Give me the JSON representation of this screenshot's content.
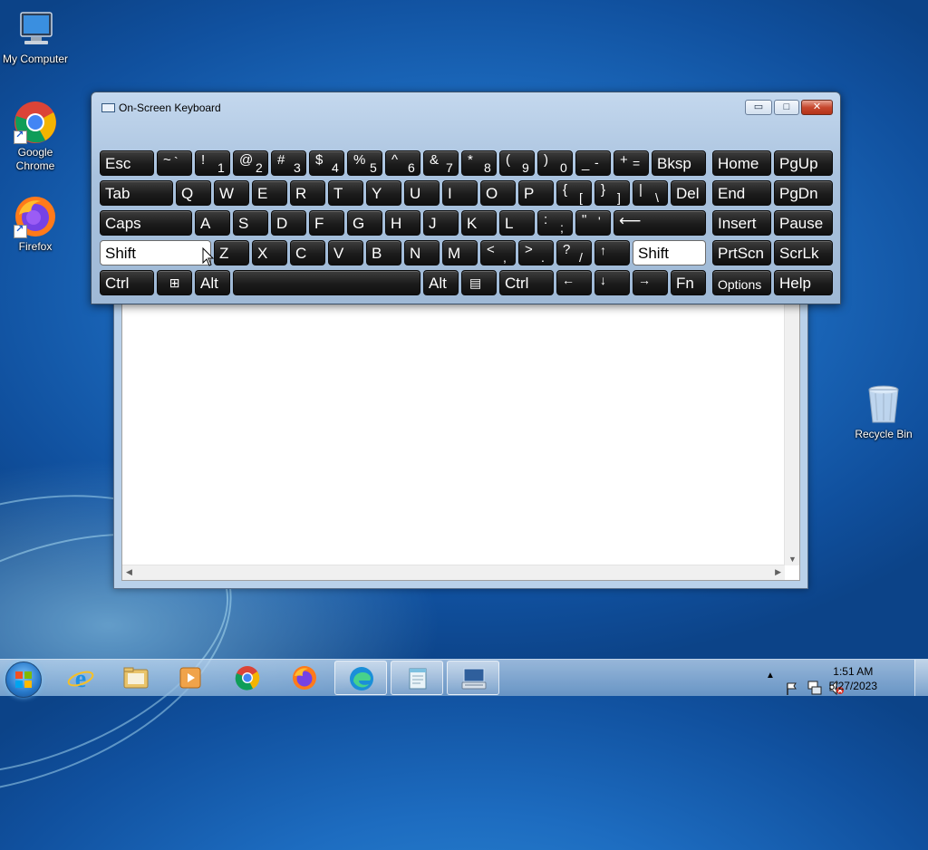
{
  "desktop": {
    "icons": [
      {
        "label": "My Computer"
      },
      {
        "label": "Google Chrome"
      },
      {
        "label": "Firefox"
      },
      {
        "label": "Recycle Bin"
      }
    ]
  },
  "osk": {
    "title": "On-Screen Keyboard",
    "caption": {
      "minimize": "▭",
      "maximize": "□",
      "close": "✕"
    },
    "keys": {
      "esc": "Esc",
      "tilde": {
        "up": "~",
        "down": "`"
      },
      "k1": {
        "up": "!",
        "down": "1"
      },
      "k2": {
        "up": "@",
        "down": "2"
      },
      "k3": {
        "up": "#",
        "down": "3"
      },
      "k4": {
        "up": "$",
        "down": "4"
      },
      "k5": {
        "up": "%",
        "down": "5"
      },
      "k6": {
        "up": "^",
        "down": "6"
      },
      "k7": {
        "up": "&",
        "down": "7"
      },
      "k8": {
        "up": "*",
        "down": "8"
      },
      "k9": {
        "up": "(",
        "down": "9"
      },
      "k0": {
        "up": ")",
        "down": "0"
      },
      "minus": {
        "up": "_",
        "down": "-"
      },
      "plus": {
        "up": "+",
        "down": "="
      },
      "bksp": "Bksp",
      "home": "Home",
      "pgup": "PgUp",
      "tab": "Tab",
      "q": "Q",
      "w": "W",
      "e": "E",
      "r": "R",
      "t": "T",
      "y": "Y",
      "u": "U",
      "i": "I",
      "o": "O",
      "p": "P",
      "lbracket": {
        "up": "{",
        "down": "["
      },
      "rbracket": {
        "up": "}",
        "down": "]"
      },
      "backslash": {
        "up": "|",
        "down": "\\"
      },
      "del": "Del",
      "end": "End",
      "pgdn": "PgDn",
      "caps": "Caps",
      "a": "A",
      "s": "S",
      "d": "D",
      "f": "F",
      "g": "G",
      "h": "H",
      "j": "J",
      "k": "K",
      "l": "L",
      "semicolon": {
        "up": ":",
        "down": ";"
      },
      "quote": {
        "up": "\"",
        "down": "'"
      },
      "enter": "⟵",
      "insert": "Insert",
      "pause": "Pause",
      "lshift": "Shift",
      "z": "Z",
      "x": "X",
      "c": "C",
      "v": "V",
      "b": "B",
      "n": "N",
      "m": "M",
      "comma": {
        "up": "<",
        "down": ","
      },
      "period": {
        "up": ">",
        "down": "."
      },
      "slash": {
        "up": "?",
        "down": "/"
      },
      "up_arrow": "↑",
      "rshift": "Shift",
      "prtscn": "PrtScn",
      "scrlk": "ScrLk",
      "lctrl": "Ctrl",
      "win": "⊞",
      "lalt": "Alt",
      "ralt": "Alt",
      "menu": "▤",
      "rctrl": "Ctrl",
      "left_arrow": "←",
      "down_arrow": "↓",
      "right_arrow": "→",
      "fn": "Fn",
      "options": "Options",
      "help": "Help"
    }
  },
  "taskbar": {
    "apps": [
      {
        "name": "Internet Explorer"
      },
      {
        "name": "File Explorer"
      },
      {
        "name": "Media Player"
      },
      {
        "name": "Google Chrome"
      },
      {
        "name": "Firefox"
      },
      {
        "name": "Microsoft Edge"
      },
      {
        "name": "Notepad"
      },
      {
        "name": "On-Screen Keyboard"
      }
    ],
    "clock": {
      "time": "1:51 AM",
      "date": "5/27/2023"
    }
  }
}
